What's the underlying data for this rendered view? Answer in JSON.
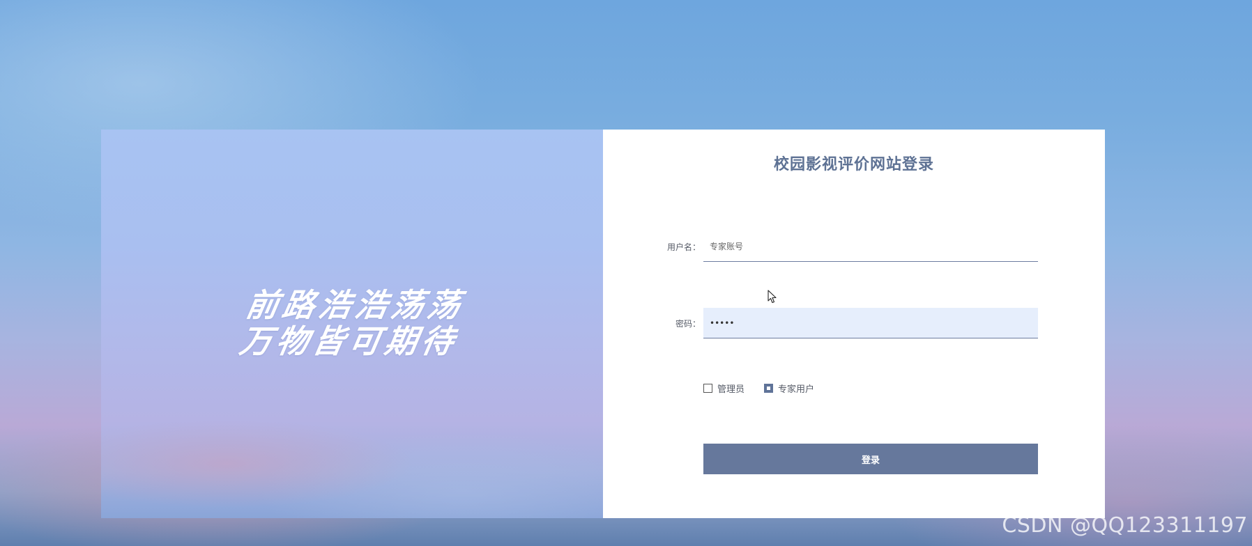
{
  "hero": {
    "slogan_line1": "前路浩浩荡荡",
    "slogan_line2": "万物皆可期待"
  },
  "login": {
    "title": "校园影视评价网站登录",
    "username": {
      "label": "用户名：",
      "placeholder": "专家账号",
      "value": ""
    },
    "password": {
      "label": "密码：",
      "value": "•••••"
    },
    "roles": [
      {
        "label": "管理员",
        "checked": false
      },
      {
        "label": "专家用户",
        "checked": true
      }
    ],
    "submit_label": "登录"
  },
  "watermark": "CSDN @QQ123311197",
  "colors": {
    "accent": "#66789c",
    "title": "#5e7294",
    "input_fill": "#e6eefc"
  }
}
